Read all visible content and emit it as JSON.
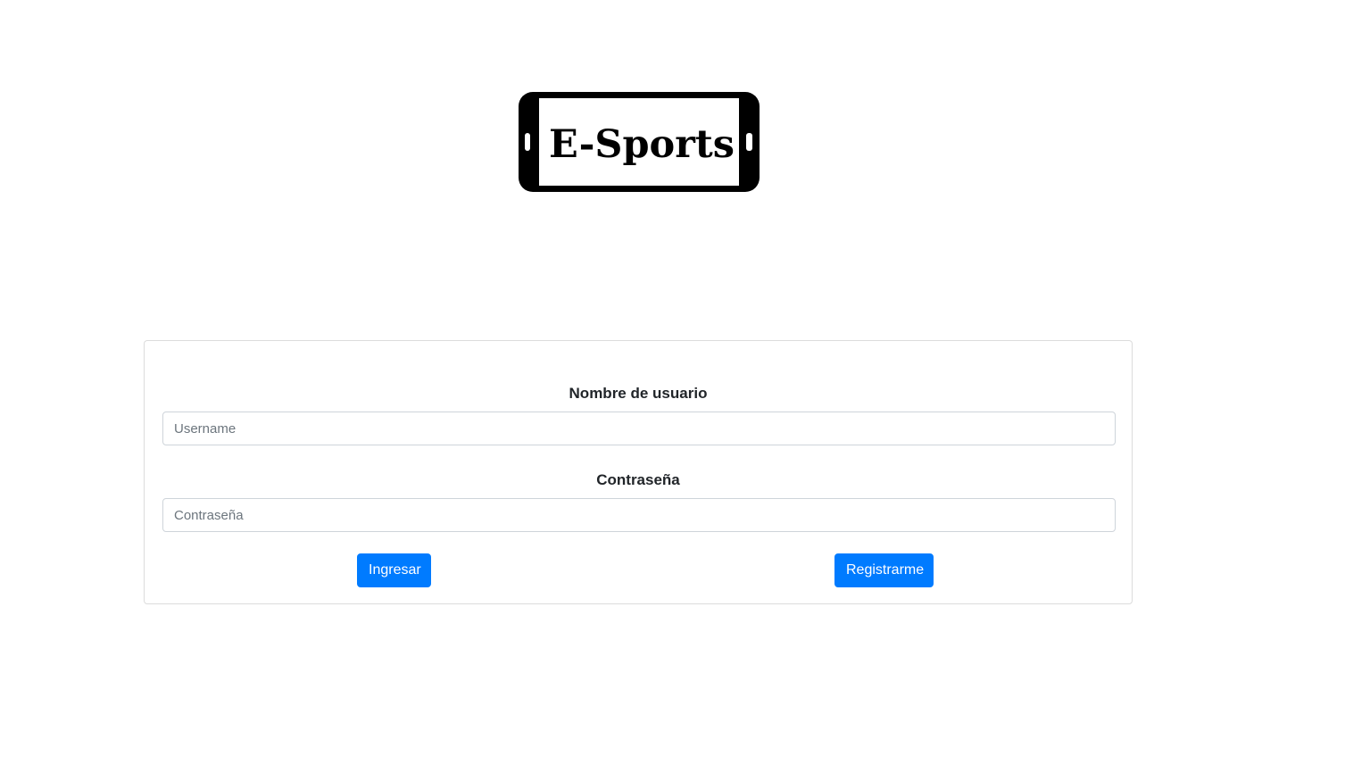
{
  "logo": {
    "text": "E-Sports"
  },
  "form": {
    "username_label": "Nombre de usuario",
    "username_placeholder": "Username",
    "password_label": "Contraseña",
    "password_placeholder": "Contraseña",
    "login_button": "Ingresar",
    "register_button": "Registrarme"
  },
  "colors": {
    "primary": "#007bff",
    "border": "#ced4da",
    "text": "#212529"
  }
}
